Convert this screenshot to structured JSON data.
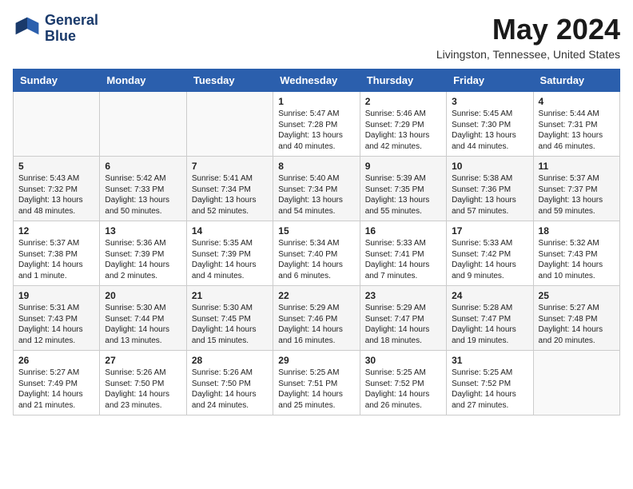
{
  "header": {
    "logo_line1": "General",
    "logo_line2": "Blue",
    "title": "May 2024",
    "subtitle": "Livingston, Tennessee, United States"
  },
  "days_of_week": [
    "Sunday",
    "Monday",
    "Tuesday",
    "Wednesday",
    "Thursday",
    "Friday",
    "Saturday"
  ],
  "weeks": [
    [
      {
        "day": "",
        "info": ""
      },
      {
        "day": "",
        "info": ""
      },
      {
        "day": "",
        "info": ""
      },
      {
        "day": "1",
        "info": "Sunrise: 5:47 AM\nSunset: 7:28 PM\nDaylight: 13 hours\nand 40 minutes."
      },
      {
        "day": "2",
        "info": "Sunrise: 5:46 AM\nSunset: 7:29 PM\nDaylight: 13 hours\nand 42 minutes."
      },
      {
        "day": "3",
        "info": "Sunrise: 5:45 AM\nSunset: 7:30 PM\nDaylight: 13 hours\nand 44 minutes."
      },
      {
        "day": "4",
        "info": "Sunrise: 5:44 AM\nSunset: 7:31 PM\nDaylight: 13 hours\nand 46 minutes."
      }
    ],
    [
      {
        "day": "5",
        "info": "Sunrise: 5:43 AM\nSunset: 7:32 PM\nDaylight: 13 hours\nand 48 minutes."
      },
      {
        "day": "6",
        "info": "Sunrise: 5:42 AM\nSunset: 7:33 PM\nDaylight: 13 hours\nand 50 minutes."
      },
      {
        "day": "7",
        "info": "Sunrise: 5:41 AM\nSunset: 7:34 PM\nDaylight: 13 hours\nand 52 minutes."
      },
      {
        "day": "8",
        "info": "Sunrise: 5:40 AM\nSunset: 7:34 PM\nDaylight: 13 hours\nand 54 minutes."
      },
      {
        "day": "9",
        "info": "Sunrise: 5:39 AM\nSunset: 7:35 PM\nDaylight: 13 hours\nand 55 minutes."
      },
      {
        "day": "10",
        "info": "Sunrise: 5:38 AM\nSunset: 7:36 PM\nDaylight: 13 hours\nand 57 minutes."
      },
      {
        "day": "11",
        "info": "Sunrise: 5:37 AM\nSunset: 7:37 PM\nDaylight: 13 hours\nand 59 minutes."
      }
    ],
    [
      {
        "day": "12",
        "info": "Sunrise: 5:37 AM\nSunset: 7:38 PM\nDaylight: 14 hours\nand 1 minute."
      },
      {
        "day": "13",
        "info": "Sunrise: 5:36 AM\nSunset: 7:39 PM\nDaylight: 14 hours\nand 2 minutes."
      },
      {
        "day": "14",
        "info": "Sunrise: 5:35 AM\nSunset: 7:39 PM\nDaylight: 14 hours\nand 4 minutes."
      },
      {
        "day": "15",
        "info": "Sunrise: 5:34 AM\nSunset: 7:40 PM\nDaylight: 14 hours\nand 6 minutes."
      },
      {
        "day": "16",
        "info": "Sunrise: 5:33 AM\nSunset: 7:41 PM\nDaylight: 14 hours\nand 7 minutes."
      },
      {
        "day": "17",
        "info": "Sunrise: 5:33 AM\nSunset: 7:42 PM\nDaylight: 14 hours\nand 9 minutes."
      },
      {
        "day": "18",
        "info": "Sunrise: 5:32 AM\nSunset: 7:43 PM\nDaylight: 14 hours\nand 10 minutes."
      }
    ],
    [
      {
        "day": "19",
        "info": "Sunrise: 5:31 AM\nSunset: 7:43 PM\nDaylight: 14 hours\nand 12 minutes."
      },
      {
        "day": "20",
        "info": "Sunrise: 5:30 AM\nSunset: 7:44 PM\nDaylight: 14 hours\nand 13 minutes."
      },
      {
        "day": "21",
        "info": "Sunrise: 5:30 AM\nSunset: 7:45 PM\nDaylight: 14 hours\nand 15 minutes."
      },
      {
        "day": "22",
        "info": "Sunrise: 5:29 AM\nSunset: 7:46 PM\nDaylight: 14 hours\nand 16 minutes."
      },
      {
        "day": "23",
        "info": "Sunrise: 5:29 AM\nSunset: 7:47 PM\nDaylight: 14 hours\nand 18 minutes."
      },
      {
        "day": "24",
        "info": "Sunrise: 5:28 AM\nSunset: 7:47 PM\nDaylight: 14 hours\nand 19 minutes."
      },
      {
        "day": "25",
        "info": "Sunrise: 5:27 AM\nSunset: 7:48 PM\nDaylight: 14 hours\nand 20 minutes."
      }
    ],
    [
      {
        "day": "26",
        "info": "Sunrise: 5:27 AM\nSunset: 7:49 PM\nDaylight: 14 hours\nand 21 minutes."
      },
      {
        "day": "27",
        "info": "Sunrise: 5:26 AM\nSunset: 7:50 PM\nDaylight: 14 hours\nand 23 minutes."
      },
      {
        "day": "28",
        "info": "Sunrise: 5:26 AM\nSunset: 7:50 PM\nDaylight: 14 hours\nand 24 minutes."
      },
      {
        "day": "29",
        "info": "Sunrise: 5:25 AM\nSunset: 7:51 PM\nDaylight: 14 hours\nand 25 minutes."
      },
      {
        "day": "30",
        "info": "Sunrise: 5:25 AM\nSunset: 7:52 PM\nDaylight: 14 hours\nand 26 minutes."
      },
      {
        "day": "31",
        "info": "Sunrise: 5:25 AM\nSunset: 7:52 PM\nDaylight: 14 hours\nand 27 minutes."
      },
      {
        "day": "",
        "info": ""
      }
    ]
  ]
}
